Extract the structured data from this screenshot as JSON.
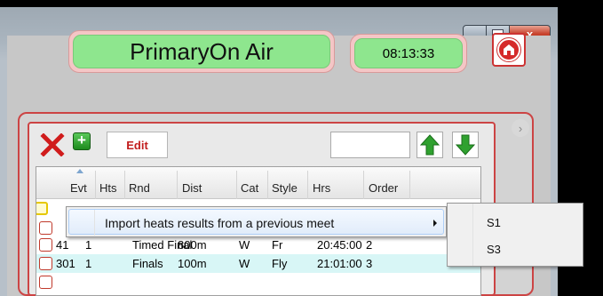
{
  "window": {
    "caption_buttons": {
      "minimize": "",
      "maximize": "",
      "close": "x"
    }
  },
  "header": {
    "on_air_text": "PrimaryOn Air",
    "clock": "08:13:33",
    "exit_icon": "door-exit-icon"
  },
  "toolbar": {
    "delete_icon": "red-x-icon",
    "add_icon": "green-plus-icon",
    "add_glyph": "+",
    "edit_label": "Edit",
    "search_value": "",
    "move_up_icon": "green-up-arrow-icon",
    "move_down_icon": "green-down-arrow-icon"
  },
  "grid": {
    "columns": [
      "Evt",
      "Hts",
      "Rnd",
      "Dist",
      "Cat",
      "Style",
      "Hrs",
      "Order"
    ],
    "rows": [
      {
        "evt": "",
        "hts": "",
        "rnd": "",
        "dist": "",
        "cat": "",
        "style": "",
        "hrs": "",
        "order": ""
      },
      {
        "evt": "",
        "hts": "",
        "rnd": "",
        "dist": "",
        "cat": "",
        "style": "",
        "hrs": "",
        "order": ""
      },
      {
        "evt": "41",
        "hts": "1",
        "rnd": "Timed Final",
        "dist": "800m",
        "cat": "W",
        "style": "Fr",
        "hrs": "20:45:00",
        "order": "2"
      },
      {
        "evt": "301",
        "hts": "1",
        "rnd": "Finals",
        "dist": "100m",
        "cat": "W",
        "style": "Fly",
        "hrs": "21:01:00",
        "order": "3"
      },
      {
        "evt": "",
        "hts": "",
        "rnd": "",
        "dist": "",
        "cat": "",
        "style": "",
        "hrs": "",
        "order": ""
      }
    ]
  },
  "context_menu": {
    "item_label": "Import heats results from a previous meet",
    "submenu": [
      "S1",
      "S3"
    ]
  },
  "colors": {
    "accent_red": "#c44444",
    "on_air_green": "#8ee68e",
    "highlight_row": "#d8f6f6"
  }
}
